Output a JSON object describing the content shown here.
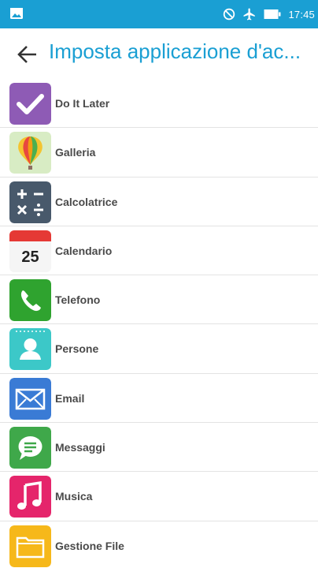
{
  "status_bar": {
    "time": "17:45"
  },
  "action_bar": {
    "title": "Imposta applicazione d'ac...",
    "back_label": "Indietro"
  },
  "apps": [
    {
      "label": "Do It Later",
      "icon": "checkmark-icon"
    },
    {
      "label": "Galleria",
      "icon": "balloon-icon"
    },
    {
      "label": "Calcolatrice",
      "icon": "calculator-icon"
    },
    {
      "label": "Calendario",
      "icon": "calendar-icon",
      "icon_text": "25"
    },
    {
      "label": "Telefono",
      "icon": "phone-icon"
    },
    {
      "label": "Persone",
      "icon": "contact-icon"
    },
    {
      "label": "Email",
      "icon": "envelope-icon"
    },
    {
      "label": "Messaggi",
      "icon": "chat-bubble-icon"
    },
    {
      "label": "Musica",
      "icon": "music-note-icon"
    },
    {
      "label": "Gestione File",
      "icon": "folder-icon"
    }
  ],
  "colors": {
    "accent": "#1a9fd3",
    "label": "#4a4a4a",
    "divider": "#e3e3e3"
  }
}
